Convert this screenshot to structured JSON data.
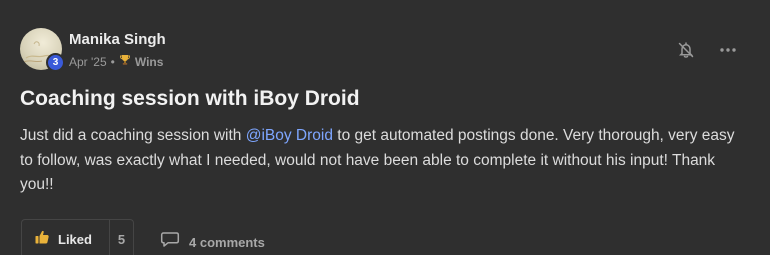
{
  "author": {
    "name": "Manika Singh",
    "level": "3",
    "date": "Apr '25",
    "separator": "•",
    "category_icon": "trophy-icon",
    "category": "Wins"
  },
  "post": {
    "title": "Coaching session with iBoy Droid",
    "body_before": "Just did a coaching session with ",
    "mention": "@iBoy Droid",
    "body_after": " to get automated postings done. Very thorough, very easy to follow, was exactly what I needed, would not have been able to complete it without his input! Thank you!!"
  },
  "actions": {
    "notify_icon": "bell-off-icon",
    "more_icon": "more-horizontal-icon"
  },
  "footer": {
    "like_label": "Liked",
    "like_count": "5",
    "comments_label": "4 comments"
  },
  "colors": {
    "background": "#2f2f2f",
    "mention": "#7ea6ff",
    "level_badge": "#3a5ad9"
  }
}
